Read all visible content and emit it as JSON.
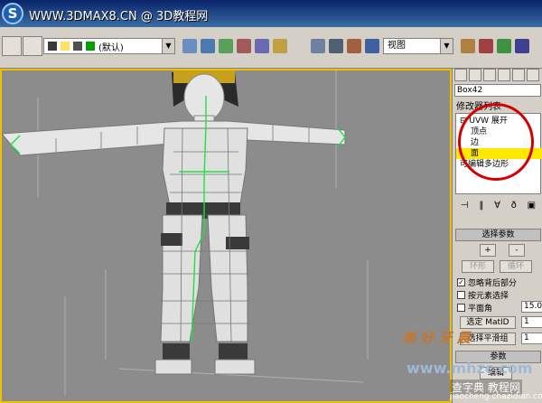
{
  "title_bar": {
    "watermark": "WWW.3DMAX8.CN @ 3D教程网"
  },
  "toolbar": {
    "layer_combo": "(默认)",
    "view_combo": "视图"
  },
  "command_panel": {
    "object_name": "Box42",
    "modifier_list_label": "修改器列表",
    "stack_items": [
      {
        "label": "⊟ UVW 展开"
      },
      {
        "label": "顶点"
      },
      {
        "label": "边"
      },
      {
        "label": "面"
      },
      {
        "label": "可编辑多边形"
      }
    ],
    "selection_rollout": {
      "title": "选择参数",
      "plus": "+",
      "minus": "-",
      "ring": "环形",
      "loop": "循环",
      "ignore_backfacing": "忽略背后部分",
      "select_by_element": "按元素选择",
      "planar_angle": "平面角",
      "planar_angle_value": "15.0",
      "select_matid": "选定 MatID",
      "matid_value": "1",
      "select_smoothing": "选择平滑组",
      "smoothing_value": "1"
    },
    "params_rollout": {
      "title": "参数",
      "edit_button": "编辑"
    }
  },
  "overlays": {
    "watermark_brand": "美 好 牙 晨",
    "watermark_site": "www.mhzc.com",
    "watermark_site2": "查字典 教程网",
    "watermark_url": "jiaocheng.chazidian.com"
  },
  "colors": {
    "viewport_bg": "#8c8c8c",
    "viewport_border": "#f0c000",
    "stack_selected": "#ffe800",
    "annotation_circle": "#d40000",
    "wire_green": "#20e040"
  }
}
